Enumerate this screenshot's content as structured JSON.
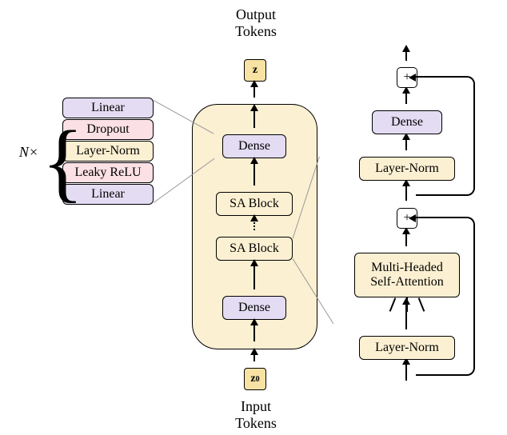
{
  "labels": {
    "output": "Output\nTokens",
    "input": "Input\nTokens",
    "z": "z",
    "z0": "z",
    "z0_sub": "0",
    "n_times": "N×"
  },
  "left_stack": {
    "items": [
      "Linear",
      "Dropout",
      "Layer-Norm",
      "Leaky ReLU",
      "Linear"
    ]
  },
  "center_stack": {
    "items": [
      "Dense",
      "SA Block",
      "SA Block",
      "Dense"
    ]
  },
  "right_stack": {
    "add_top": "+",
    "dense": "Dense",
    "ln_top": "Layer-Norm",
    "add_mid": "+",
    "mhsa_line1": "Multi-Headed",
    "mhsa_line2": "Self-Attention",
    "ln_bottom": "Layer-Norm"
  }
}
